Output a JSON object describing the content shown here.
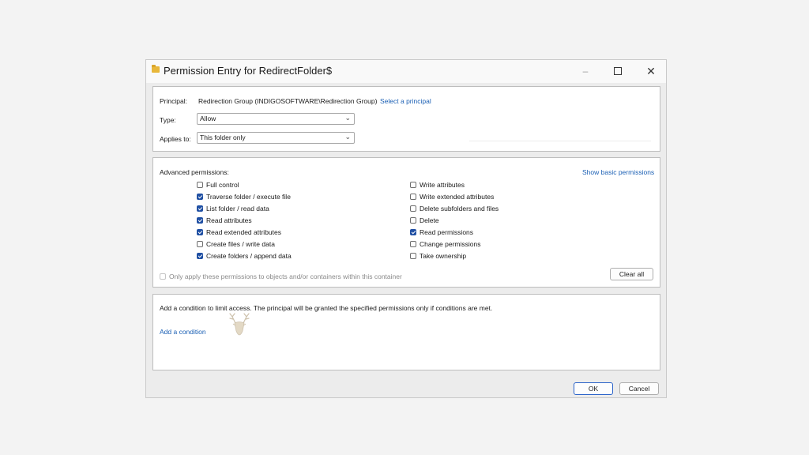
{
  "window": {
    "title": "Permission Entry for RedirectFolder$",
    "controls": {
      "minimize": "–",
      "close": "✕"
    }
  },
  "principal": {
    "label": "Principal:",
    "value": "Redirection Group (INDIGOSOFTWARE\\Redirection Group)",
    "select_link": "Select a principal"
  },
  "type": {
    "label": "Type:",
    "value": "Allow"
  },
  "applies_to": {
    "label": "Applies to:",
    "value": "This folder only"
  },
  "advanced": {
    "heading": "Advanced permissions:",
    "show_basic_link": "Show basic permissions",
    "left_permissions": [
      {
        "label": "Full control",
        "checked": false
      },
      {
        "label": "Traverse folder / execute file",
        "checked": true
      },
      {
        "label": "List folder / read data",
        "checked": true
      },
      {
        "label": "Read attributes",
        "checked": true
      },
      {
        "label": "Read extended attributes",
        "checked": true
      },
      {
        "label": "Create files / write data",
        "checked": false
      },
      {
        "label": "Create folders / append data",
        "checked": true
      }
    ],
    "right_permissions": [
      {
        "label": "Write attributes",
        "checked": false
      },
      {
        "label": "Write extended attributes",
        "checked": false
      },
      {
        "label": "Delete subfolders and files",
        "checked": false
      },
      {
        "label": "Delete",
        "checked": false
      },
      {
        "label": "Read permissions",
        "checked": true
      },
      {
        "label": "Change permissions",
        "checked": false
      },
      {
        "label": "Take ownership",
        "checked": false
      }
    ],
    "only_apply_label": "Only apply these permissions to objects and/or containers within this container",
    "clear_all": "Clear all"
  },
  "condition": {
    "description": "Add a condition to limit access. The principal will be granted the specified permissions only if conditions are met.",
    "add_link": "Add a condition"
  },
  "footer": {
    "ok": "OK",
    "cancel": "Cancel"
  },
  "colors": {
    "accent": "#1f4fa3",
    "link": "#1a5fb4",
    "folder_icon": "#e8b73a"
  }
}
